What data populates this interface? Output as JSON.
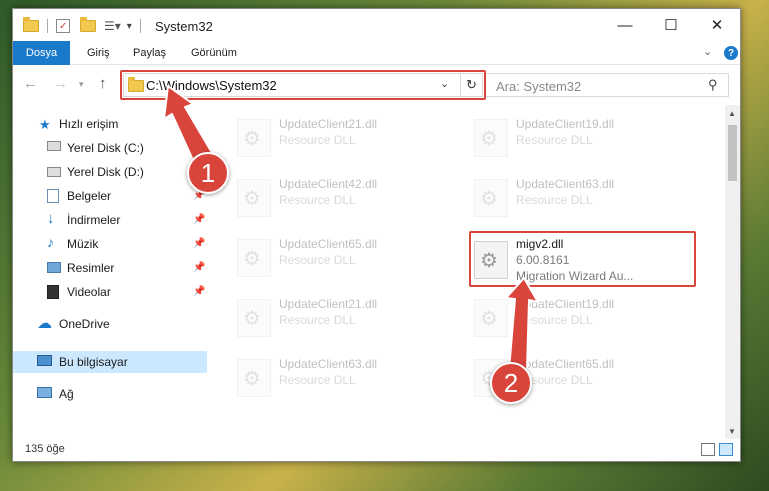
{
  "window": {
    "title": "System32",
    "controls": {
      "minimize": "—",
      "maximize": "☐",
      "close": "✕"
    }
  },
  "ribbon": {
    "tabs": [
      "Dosya",
      "Giriş",
      "Paylaş",
      "Görünüm"
    ]
  },
  "nav": {
    "address": "C:\\Windows\\System32",
    "search_placeholder": "Ara: System32"
  },
  "sidebar": {
    "items": [
      {
        "label": "Hızlı erişim",
        "icon": "star-icon"
      },
      {
        "label": "Yerel Disk (C:)",
        "icon": "drive-icon"
      },
      {
        "label": "Yerel Disk (D:)",
        "icon": "drive-icon"
      },
      {
        "label": "Belgeler",
        "icon": "documents-icon"
      },
      {
        "label": "İndirmeler",
        "icon": "download-icon"
      },
      {
        "label": "Müzik",
        "icon": "music-icon"
      },
      {
        "label": "Resimler",
        "icon": "pictures-icon"
      },
      {
        "label": "Videolar",
        "icon": "video-icon"
      },
      {
        "label": "OneDrive",
        "icon": "cloud-icon"
      },
      {
        "label": "Bu bilgisayar",
        "icon": "computer-icon"
      },
      {
        "label": "Ağ",
        "icon": "network-icon"
      }
    ]
  },
  "files": [
    {
      "name": "UpdateClient21.dll",
      "desc": "Resource DLL"
    },
    {
      "name": "UpdateClient19.dll",
      "desc": "Resource DLL"
    },
    {
      "name": "UpdateClient42.dll",
      "desc": "Resource DLL"
    },
    {
      "name": "UpdateClient63.dll",
      "desc": "Resource DLL"
    },
    {
      "name": "UpdateClient65.dll",
      "desc": "Resource DLL"
    },
    {
      "name": "migv2.dll",
      "version": "6.00.8161",
      "desc": "Migration Wizard Au..."
    },
    {
      "name": "UpdateClient21.dll",
      "desc": "Resource DLL"
    },
    {
      "name": "UpdateClient19.dll",
      "desc": "Resource DLL"
    },
    {
      "name": "UpdateClient63.dll",
      "desc": "Resource DLL"
    },
    {
      "name": "UpdateClient65.dll",
      "desc": "Resource DLL"
    }
  ],
  "status": {
    "count": "135 öğe"
  },
  "callouts": {
    "one": "1",
    "two": "2"
  },
  "colors": {
    "accent": "#1979ca",
    "highlight": "#d9443b",
    "selection": "#cce8ff"
  }
}
